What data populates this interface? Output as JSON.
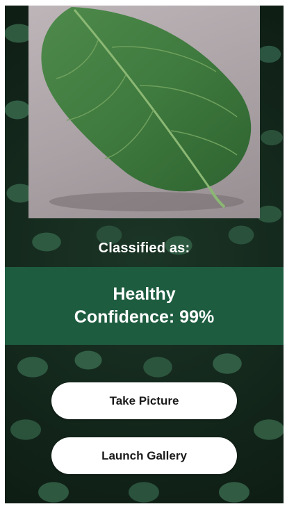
{
  "classification": {
    "label": "Classified as:",
    "result": "Healthy",
    "confidence": "Confidence: 99%"
  },
  "buttons": {
    "take_picture": "Take Picture",
    "launch_gallery": "Launch Gallery"
  },
  "colors": {
    "result_band": "#1d5c3f",
    "button_bg": "#ffffff",
    "background": "#0f1f16"
  }
}
